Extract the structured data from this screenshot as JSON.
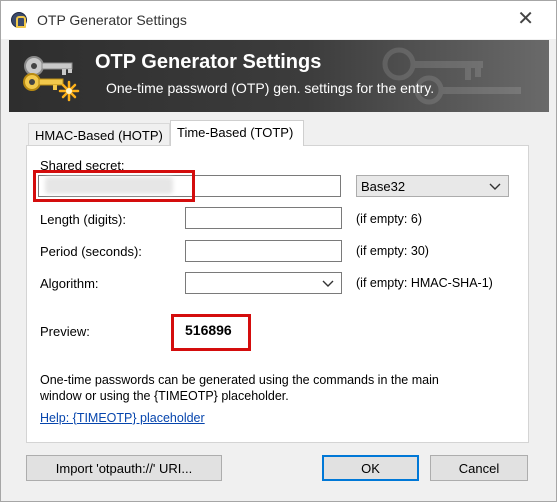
{
  "window": {
    "title": "OTP Generator Settings",
    "close_glyph": "✕",
    "icon": "keepass-lock-icon"
  },
  "banner": {
    "title": "OTP Generator Settings",
    "subtitle": "One-time password (OTP) gen. settings for the entry.",
    "icon": "keys-star-icon"
  },
  "tabs": [
    {
      "label": "HMAC-Based (HOTP)",
      "selected": false
    },
    {
      "label": "Time-Based (TOTP)",
      "selected": true
    }
  ],
  "form": {
    "shared_secret": {
      "label": "Shared secret:",
      "value": "",
      "redacted": true
    },
    "encoding": {
      "selected": "Base32"
    },
    "length": {
      "label": "Length (digits):",
      "value": "",
      "hint": "(if empty: 6)"
    },
    "period": {
      "label": "Period (seconds):",
      "value": "",
      "hint": "(if empty: 30)"
    },
    "algorithm": {
      "label": "Algorithm:",
      "selected": "",
      "hint": "(if empty: HMAC-SHA-1)"
    },
    "preview": {
      "label": "Preview:",
      "value": "516896"
    }
  },
  "note": {
    "line1": "One-time passwords can be generated using the commands in the main",
    "line2": "window or using the {TIMEOTP} placeholder."
  },
  "help_link": "Help: {TIMEOTP} placeholder",
  "buttons": {
    "import": "Import 'otpauth://' URI...",
    "ok": "OK",
    "cancel": "Cancel"
  },
  "colors": {
    "highlight_red": "#d40d0d",
    "link_blue": "#0645ad",
    "default_button_border": "#0078d7"
  }
}
